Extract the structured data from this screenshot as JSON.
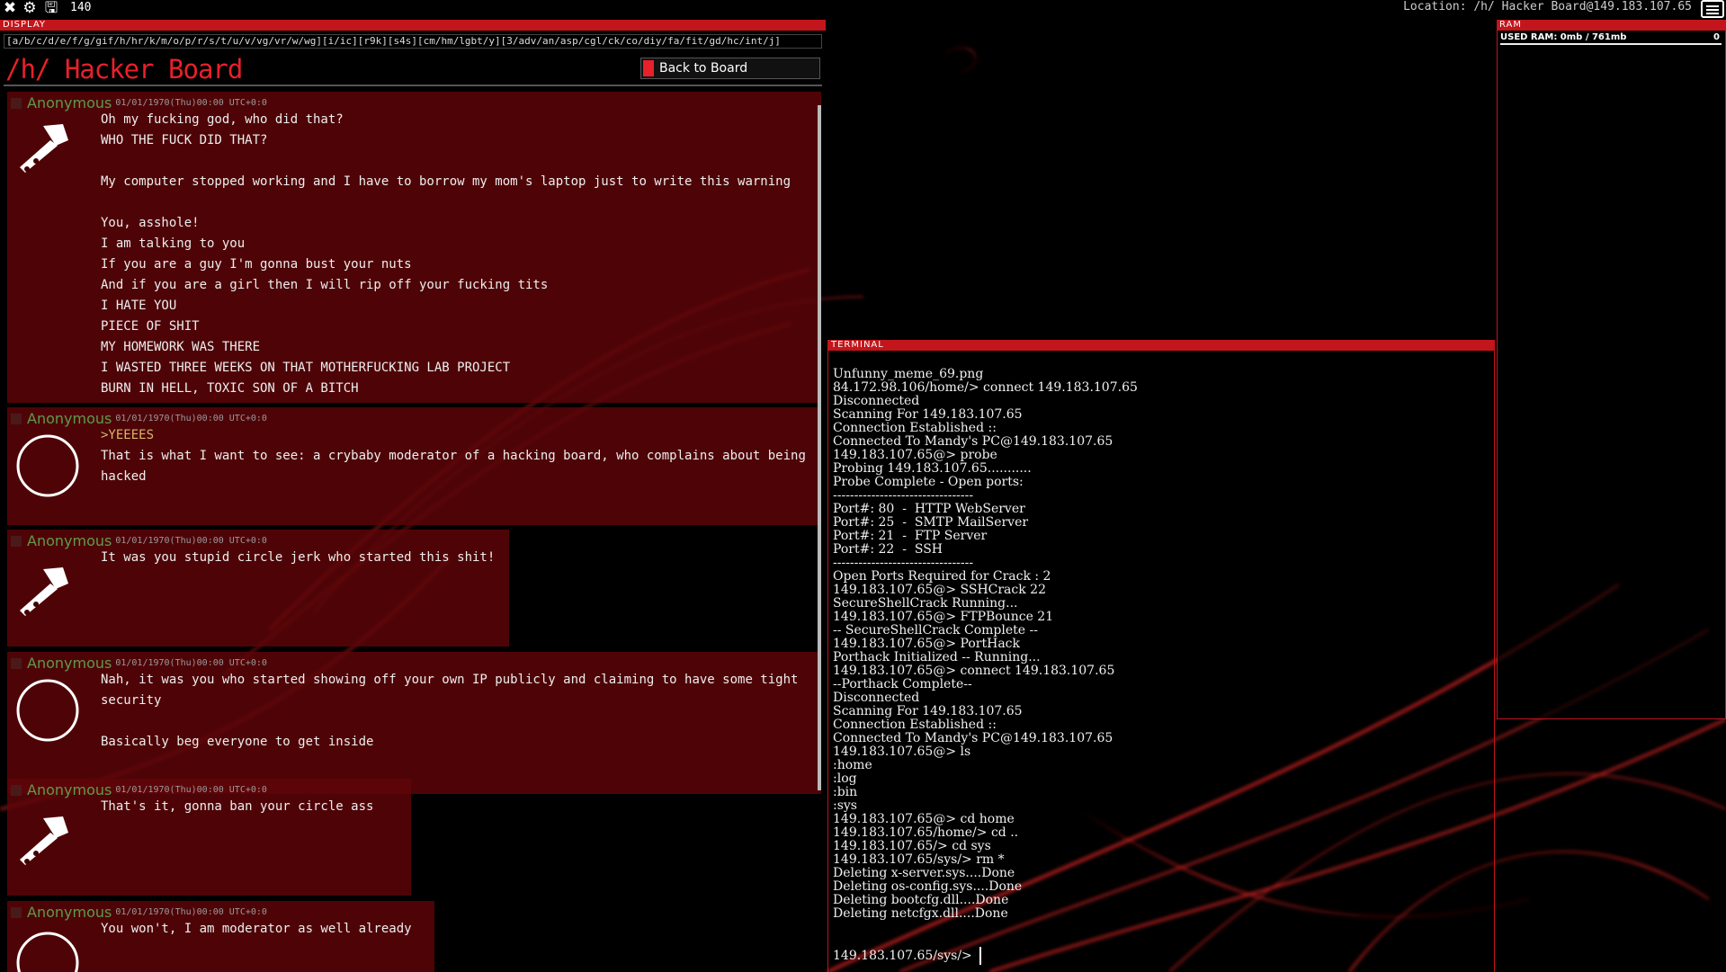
{
  "topbar": {
    "icons": [
      "close-icon",
      "gear-icon",
      "save-icon"
    ],
    "counter": "140",
    "location": "Location: /h/ Hacker Board@149.183.107.65",
    "chat_icon": "chat-icon"
  },
  "display": {
    "header": "DISPLAY",
    "boards": "[a/b/c/d/e/f/g/gif/h/hr/k/m/o/p/r/s/t/u/v/vg/vr/w/wg][i/ic][r9k][s4s][cm/hm/lgbt/y][3/adv/an/asp/cgl/ck/co/diy/fa/fit/gd/hc/int/j]",
    "title": "/h/ Hacker Board",
    "back_button": "Back to Board",
    "posts": [
      {
        "name": "Anonymous",
        "date": "01/01/1970(Thu)00:00 UTC+0:0",
        "icon": "hammer-icon",
        "lines": [
          "Oh my fucking god, who did that?",
          "WHO THE FUCK DID THAT?",
          "",
          "My computer stopped working and I have to borrow my mom's laptop just to write this warning",
          "",
          "You, asshole!",
          "I am talking to you",
          "If you are a guy I'm gonna bust your nuts",
          "And if you are a girl then I will rip off your fucking tits",
          "I HATE YOU",
          "PIECE OF SHIT",
          "MY HOMEWORK WAS THERE",
          "I WASTED THREE WEEKS ON THAT MOTHERFUCKING LAB PROJECT",
          "BURN IN HELL, TOXIC SON OF A BITCH"
        ]
      },
      {
        "name": "Anonymous",
        "date": "01/01/1970(Thu)00:00 UTC+0:0",
        "icon": "circle-icon",
        "greentext": ">YEEEES",
        "lines": [
          "That is what I want to see: a crybaby moderator of a hacking board, who complains about being",
          "hacked"
        ]
      },
      {
        "name": "Anonymous",
        "date": "01/01/1970(Thu)00:00 UTC+0:0",
        "icon": "hammer-icon",
        "lines": [
          "It was you stupid circle jerk who started this shit!"
        ]
      },
      {
        "name": "Anonymous",
        "date": "01/01/1970(Thu)00:00 UTC+0:0",
        "icon": "circle-icon",
        "lines": [
          "Nah, it was you who started showing off your own IP publicly and claiming to have some tight",
          "security",
          "",
          "Basically beg everyone to get inside"
        ]
      },
      {
        "name": "Anonymous",
        "date": "01/01/1970(Thu)00:00 UTC+0:0",
        "icon": "hammer-icon",
        "lines": [
          "That's it, gonna ban your circle ass"
        ]
      },
      {
        "name": "Anonymous",
        "date": "01/01/1970(Thu)00:00 UTC+0:0",
        "icon": "circle-icon",
        "lines": [
          "You won't, I am moderator as well already"
        ]
      }
    ]
  },
  "ram": {
    "header": "RAM",
    "used": "USED RAM: 0mb / 761mb",
    "count": "0"
  },
  "terminal": {
    "header": "TERMINAL",
    "lines": [
      "Unfunny_meme_69.png",
      "84.172.98.106/home/> connect 149.183.107.65",
      "Disconnected",
      "Scanning For 149.183.107.65",
      "Connection Established ::",
      "Connected To Mandy's PC@149.183.107.65",
      "149.183.107.65@> probe",
      "Probing 149.183.107.65...........",
      "Probe Complete - Open ports:",
      "---------------------------------",
      "Port#: 80  -  HTTP WebServer",
      "Port#: 25  -  SMTP MailServer",
      "Port#: 21  -  FTP Server",
      "Port#: 22  -  SSH",
      "---------------------------------",
      "Open Ports Required for Crack : 2",
      "149.183.107.65@> SSHCrack 22",
      "SecureShellCrack Running...",
      "149.183.107.65@> FTPBounce 21",
      "-- SecureShellCrack Complete --",
      "149.183.107.65@> PortHack",
      "Porthack Initialized -- Running...",
      "149.183.107.65@> connect 149.183.107.65",
      "--Porthack Complete--",
      "Disconnected",
      "Scanning For 149.183.107.65",
      "Connection Established ::",
      "Connected To Mandy's PC@149.183.107.65",
      "149.183.107.65@> ls",
      ":home",
      ":log",
      ":bin",
      ":sys",
      "149.183.107.65@> cd home",
      "149.183.107.65/home/> cd ..",
      "149.183.107.65/> cd sys",
      "149.183.107.65/sys/> rm *",
      "Deleting x-server.sys....Done",
      "Deleting os-config.sys....Done",
      "Deleting bootcfg.dll....Done",
      "Deleting netcfgx.dll....Done"
    ],
    "prompt": "149.183.107.65/sys/>"
  },
  "colors": {
    "accent": "#c2161c",
    "post_bg": "#5f0508",
    "name_green": "#5f9a4a",
    "greentext": "#d7b86d"
  }
}
